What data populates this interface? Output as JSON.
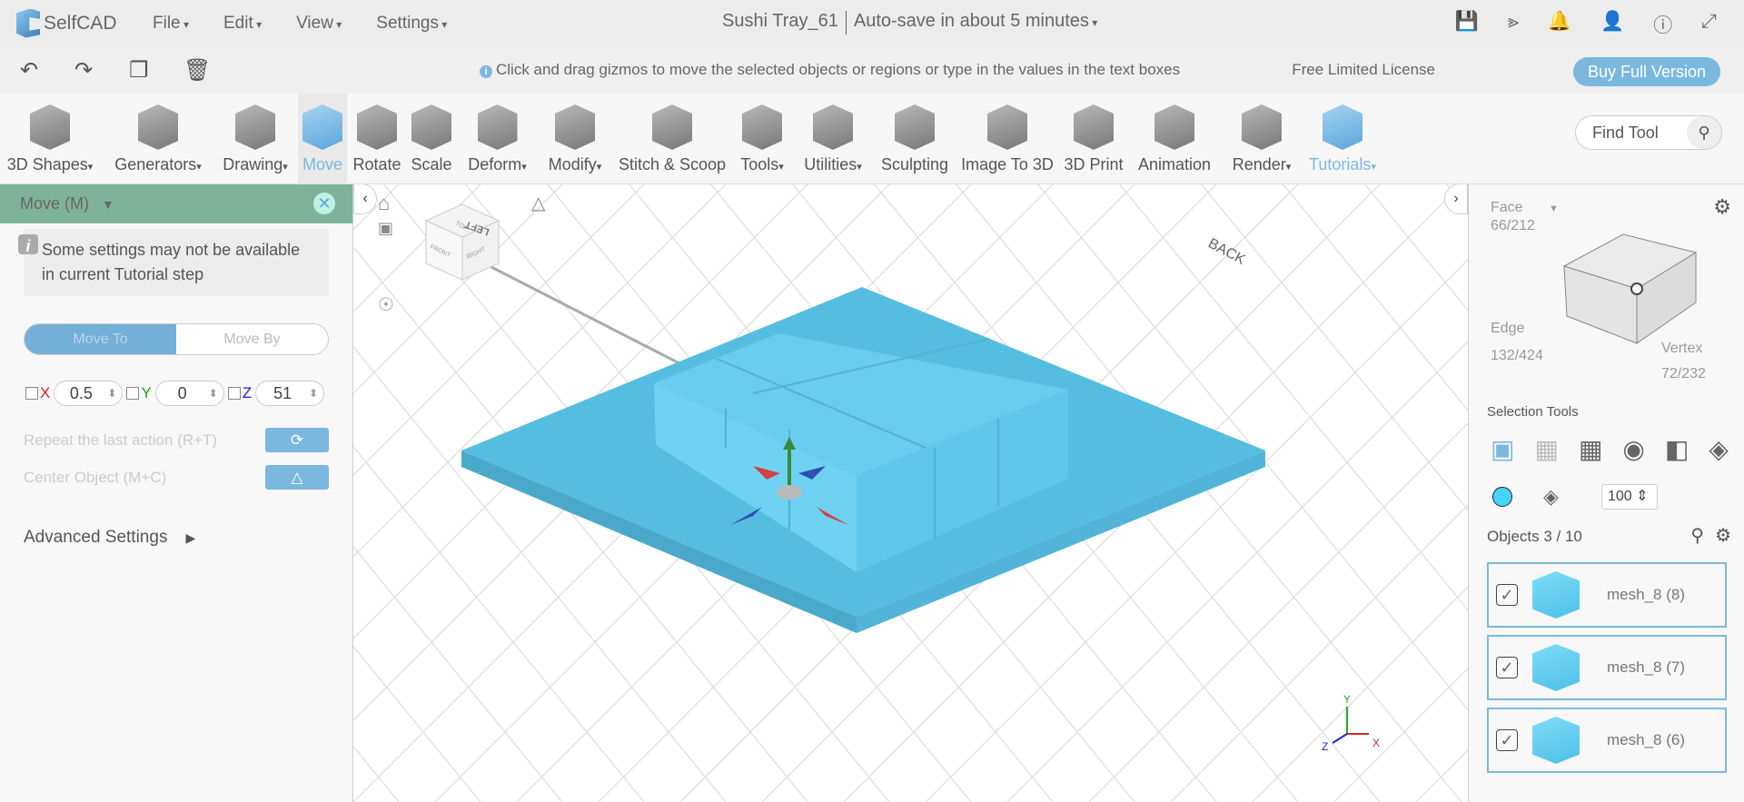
{
  "app": {
    "name": "SelfCAD",
    "menus": [
      "File",
      "Edit",
      "View",
      "Settings"
    ],
    "project_title": "Sushi Tray_61",
    "autosave": "Auto-save in about 5 minutes",
    "top_icons": [
      "save-icon",
      "share-icon",
      "bell-icon",
      "user-icon",
      "info-icon",
      "fullscreen-icon"
    ]
  },
  "toolbar2": {
    "icons": [
      "undo-icon",
      "redo-icon",
      "copy-icon",
      "delete-icon"
    ],
    "hint": "Click and drag gizmos to move the selected objects or regions or type in the values in the text boxes",
    "license": "Free Limited License",
    "buy": "Buy Full Version"
  },
  "ribbon": {
    "tools": [
      {
        "label": "3D Shapes",
        "dd": true
      },
      {
        "label": "Generators",
        "dd": true
      },
      {
        "label": "Drawing",
        "dd": true
      },
      {
        "label": "Move",
        "dd": false
      },
      {
        "label": "Rotate",
        "dd": false
      },
      {
        "label": "Scale",
        "dd": false
      },
      {
        "label": "Deform",
        "dd": true
      },
      {
        "label": "Modify",
        "dd": true
      },
      {
        "label": "Stitch & Scoop",
        "dd": false
      },
      {
        "label": "Tools",
        "dd": true
      },
      {
        "label": "Utilities",
        "dd": true
      },
      {
        "label": "Sculpting",
        "dd": false
      },
      {
        "label": "Image To 3D",
        "dd": false
      },
      {
        "label": "3D Print",
        "dd": false
      },
      {
        "label": "Animation",
        "dd": false
      },
      {
        "label": "Render",
        "dd": true
      },
      {
        "label": "Tutorials",
        "dd": true
      }
    ],
    "find_tool": "Find Tool"
  },
  "left_panel": {
    "title": "Move (M)",
    "note": "Some settings may not be available in current Tutorial step",
    "move_to": "Move To",
    "move_by": "Move By",
    "axes": [
      {
        "label": "X",
        "value": "0.5",
        "color": "#e02020"
      },
      {
        "label": "Y",
        "value": "0",
        "color": "#20a020"
      },
      {
        "label": "Z",
        "value": "51",
        "color": "#2020e0"
      }
    ],
    "repeat": "Repeat the last action (R+T)",
    "center": "Center Object (M+C)",
    "advanced": "Advanced Settings"
  },
  "viewport": {
    "cube_faces": [
      "TOP",
      "FRONT",
      "RIGHT",
      "LEFT"
    ],
    "back_label": "BACK",
    "axis_labels": [
      "Y",
      "Z",
      "X"
    ],
    "plate_color": "#55bde0"
  },
  "right_panel": {
    "face": "Face",
    "face_count": "66/212",
    "edge": "Edge",
    "edge_count": "132/424",
    "vertex": "Vertex",
    "vertex_count": "72/232",
    "selection_tools": "Selection Tools",
    "color": "#44d4ff",
    "opacity": "100",
    "objects": "Objects 3 / 10",
    "object_items": [
      {
        "name": "mesh_8 (8)",
        "checked": true
      },
      {
        "name": "mesh_8 (7)",
        "checked": true
      },
      {
        "name": "mesh_8 (6)",
        "checked": true
      }
    ]
  }
}
